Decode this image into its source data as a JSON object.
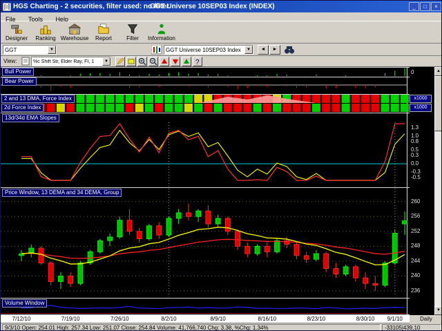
{
  "window": {
    "title": "HGS Charting - 2 securities, filter used: no filter",
    "title_secondary": "GGT Universe 10SEP03 Index (INDEX)",
    "menu": [
      "File",
      "Tools",
      "Help"
    ],
    "buttons": {
      "minimize": "_",
      "maximize": "□",
      "close": "×"
    }
  },
  "toolbar": {
    "items": [
      {
        "label": "Designer"
      },
      {
        "label": "Ranking"
      },
      {
        "label": "Warehouse"
      },
      {
        "label": "Report"
      },
      {
        "label": "Filter"
      },
      {
        "label": "Information"
      }
    ]
  },
  "symbol_bar": {
    "symbol": "GGT",
    "universe": "GGT Universe 10SEP03 Index"
  },
  "view_bar": {
    "label": "View:",
    "view": "%c Shift Str, Elder Ray, FI, 1"
  },
  "panels": {
    "bull_title": "Bull Power",
    "bear_title": "Bear Power",
    "dma_title": "2 and 13 DMA, Force Index",
    "fi2_title": "2d Force Index",
    "slopes_title": "13d/34d EMA Slopes",
    "price_title": "Price Window, 13 DEMA and 34 DEMA, Group",
    "volume_title": "Volume Window",
    "bull_zero": "0",
    "x1000": "x1000"
  },
  "status": {
    "summary": "9/3/10 Open: 254.01 High: 257.34 Low: 251.07 Close: 254.84 Volume: 41,766,740 Chg: 3.38, %Chg: 1.34%",
    "periodicity": "Daily",
    "coords": "-33105|439,10"
  },
  "colors": {
    "up_fill": "#00c000",
    "up_stroke": "#00ff00",
    "down_fill": "#e00000",
    "down_stroke": "#ff3030",
    "ema13": "#ffff00",
    "ema34": "#ff2020",
    "slope13": "#ff3030",
    "slope34": "#e8e800",
    "zero_line": "#00d0d0",
    "volume_line": "#2020ff",
    "grid": "#6a6a00",
    "bull": "#00ff00",
    "bear": "#ff0000"
  },
  "chart_data": {
    "type": "candlestick",
    "title": "GGT Universe 10SEP03 Index, Daily",
    "price_scale": [
      260,
      256,
      252,
      248,
      244,
      240,
      236
    ],
    "slopes_scale": [
      1.3,
      1.0,
      0.8,
      0.5,
      0.3,
      0.0,
      -0.3,
      -0.5
    ],
    "ticks": [
      {
        "i": 0,
        "label": "7/12/10"
      },
      {
        "i": 5,
        "label": "7/19/10"
      },
      {
        "i": 10,
        "label": "7/26/10"
      },
      {
        "i": 15,
        "label": "8/2/10"
      },
      {
        "i": 20,
        "label": "8/9/10"
      },
      {
        "i": 25,
        "label": "8/16/10"
      },
      {
        "i": 30,
        "label": "8/23/10"
      },
      {
        "i": 35,
        "label": "8/30/10"
      },
      {
        "i": 38,
        "label": "9/1/10"
      }
    ],
    "month_lines": [
      15,
      38
    ],
    "candles": [
      [
        245.5,
        247.0,
        244.0,
        246.0
      ],
      [
        246.0,
        248.5,
        245.0,
        247.5
      ],
      [
        247.5,
        248.0,
        243.0,
        243.5
      ],
      [
        243.5,
        244.0,
        237.5,
        238.5
      ],
      [
        238.5,
        241.0,
        236.5,
        240.0
      ],
      [
        240.0,
        241.0,
        237.0,
        238.0
      ],
      [
        238.0,
        244.0,
        237.5,
        243.5
      ],
      [
        243.5,
        247.0,
        243.0,
        246.5
      ],
      [
        246.5,
        250.0,
        246.0,
        249.5
      ],
      [
        249.5,
        251.5,
        248.0,
        250.5
      ],
      [
        250.5,
        256.0,
        250.0,
        255.0
      ],
      [
        255.0,
        258.0,
        251.0,
        252.0
      ],
      [
        252.0,
        253.0,
        249.0,
        250.0
      ],
      [
        250.0,
        254.0,
        249.5,
        253.5
      ],
      [
        253.5,
        254.5,
        250.0,
        251.0
      ],
      [
        251.0,
        256.0,
        250.5,
        255.5
      ],
      [
        255.5,
        258.0,
        254.0,
        257.0
      ],
      [
        257.0,
        259.5,
        255.0,
        256.0
      ],
      [
        256.0,
        258.0,
        254.5,
        257.5
      ],
      [
        257.5,
        259.0,
        253.0,
        254.0
      ],
      [
        254.0,
        256.5,
        253.0,
        255.5
      ],
      [
        255.5,
        256.0,
        251.0,
        252.0
      ],
      [
        252.0,
        252.5,
        247.0,
        248.0
      ],
      [
        248.0,
        249.0,
        245.0,
        246.0
      ],
      [
        246.0,
        248.5,
        245.5,
        248.0
      ],
      [
        248.0,
        249.0,
        245.0,
        246.5
      ],
      [
        246.5,
        250.0,
        246.0,
        249.5
      ],
      [
        249.5,
        250.5,
        247.5,
        248.5
      ],
      [
        248.5,
        249.0,
        244.5,
        245.5
      ],
      [
        245.5,
        246.5,
        243.5,
        244.5
      ],
      [
        244.5,
        247.0,
        244.0,
        246.0
      ],
      [
        246.0,
        246.5,
        241.0,
        242.0
      ],
      [
        242.0,
        243.5,
        239.5,
        240.5
      ],
      [
        240.5,
        243.0,
        240.0,
        242.5
      ],
      [
        242.5,
        243.0,
        238.5,
        239.5
      ],
      [
        239.5,
        241.0,
        236.5,
        238.0
      ],
      [
        238.0,
        240.0,
        236.0,
        237.5
      ],
      [
        237.5,
        244.0,
        237.0,
        243.5
      ],
      [
        243.5,
        252.5,
        243.0,
        251.5
      ],
      [
        254.01,
        257.34,
        251.07,
        254.84
      ]
    ],
    "bull_power": [
      0.2,
      0.3,
      0.1,
      0,
      0,
      0.1,
      0.3,
      0.35,
      0.4,
      0.3,
      0.5,
      0.2,
      0.1,
      0.3,
      0.2,
      0.4,
      0.5,
      0.3,
      0.4,
      0.2,
      0.3,
      0.1,
      0,
      0,
      0.1,
      0.1,
      0.3,
      0.2,
      0,
      0,
      0.2,
      0,
      0,
      0.1,
      0,
      0,
      0,
      0.4,
      0.7,
      1.0
    ],
    "bear_power": [
      0,
      0,
      0.4,
      0.9,
      0.3,
      0.5,
      0.1,
      0,
      0,
      0,
      0,
      0.5,
      0.4,
      0,
      0.3,
      0,
      0,
      0.2,
      0,
      0.4,
      0,
      0.3,
      0.7,
      0.5,
      0.1,
      0.3,
      0,
      0.2,
      0.5,
      0.4,
      0,
      0.6,
      0.5,
      0.1,
      0.5,
      0.6,
      0.4,
      0,
      0,
      0
    ],
    "dma_strip": [
      "g",
      "g",
      "g",
      "r",
      "r",
      "r",
      "g",
      "g",
      "g",
      "g",
      "g",
      "g",
      "g",
      "g",
      "g",
      "g",
      "g",
      "g",
      "y",
      "y",
      "r",
      "r",
      "r",
      "r",
      "r",
      "r",
      "y",
      "g",
      "r",
      "r",
      "r",
      "r",
      "r",
      "g",
      "r",
      "r",
      "r",
      "g",
      "g",
      "g"
    ],
    "fi2_strip": [
      "g",
      "g",
      "r",
      "r",
      "y",
      "r",
      "g",
      "g",
      "g",
      "g",
      "g",
      "r",
      "y",
      "g",
      "r",
      "g",
      "g",
      "y",
      "g",
      "r",
      "g",
      "r",
      "r",
      "r",
      "g",
      "r",
      "g",
      "r",
      "r",
      "r",
      "g",
      "r",
      "r",
      "g",
      "r",
      "r",
      "r",
      "g",
      "g",
      "g"
    ],
    "pink_start": 18,
    "pink_wave": [
      0,
      3,
      6,
      9,
      7,
      5,
      8,
      11,
      9,
      6,
      4,
      2,
      0
    ],
    "volume": [
      38,
      42,
      55,
      60,
      45,
      40,
      36,
      38,
      41,
      39,
      44,
      52,
      40,
      37,
      35,
      42,
      44,
      47,
      40,
      43,
      38,
      40,
      48,
      45,
      36,
      38,
      35,
      36,
      40,
      38,
      34,
      44,
      40,
      33,
      36,
      38,
      36,
      42,
      45,
      42
    ]
  }
}
